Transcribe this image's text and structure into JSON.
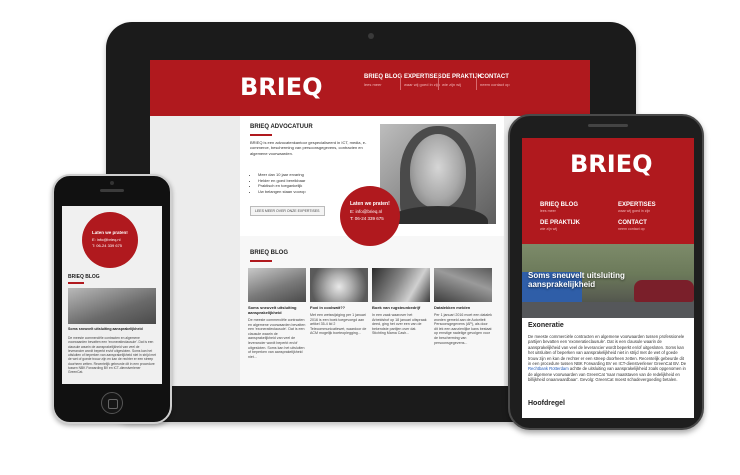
{
  "tablet": {
    "logo": "BRIEQ",
    "nav": [
      {
        "label": "BRIEQ BLOG",
        "sub": "lees meer"
      },
      {
        "label": "EXPERTISES",
        "sub": "waar wij goed in zijn"
      },
      {
        "label": "DE PRAKTIJK",
        "sub": "wie zijn wij"
      },
      {
        "label": "CONTACT",
        "sub": "neem contact op"
      }
    ],
    "about": {
      "title": "BRIEQ ADVOCATUUR",
      "text": "BRIEQ is een advocatenkantoor gespecialiseerd in ICT, media, e-commerce, bescherming van persoonsgegevens, contracten en algemene voorwaarden.",
      "bullets": [
        "Meer dan 10 jaar ervaring",
        "Helder en goed bereikbaar",
        "Praktisch en toegankelijk",
        "Uw belangen staan voorop"
      ],
      "button": "LEES MEER OVER ONZE EXPERTISES"
    },
    "contact": {
      "title": "Laten we praten!",
      "email": "E: info@brieq.nl",
      "phone": "T: 06-24 339 675"
    },
    "blog": {
      "title": "BRIEQ BLOG",
      "cards": [
        {
          "title": "Soms sneuvelt uitsluiting aansprakelijkheid",
          "text": "De meeste commerciële contracten en algemene voorwaarden bevatten een 'exoneratieclausule'. Dat is een clausule waarin de aansprakelijkheid van veel de leverancier wordt beperkt en/of uitgesloten. Soms kan het uitsluiten of beperken van aansprakelijkheid niet..."
        },
        {
          "title": "Foxi in coolwatt??",
          "text": "Met een wetswijziging per 1 januari 2016 is een boek toegevoegd aan artikel 35-4 lid 2 Telecommunicatiewet, waardoor de ACM mogelijk boeteoplegging..."
        },
        {
          "title": "Boek van rugsteunbedrijf",
          "text": "In een zaak waarover het Arbeidshof op 18 januari uitspraak deed, ging het over een van de bekendste partijen over dat. Stichting Mama Cash..."
        },
        {
          "title": "Datalekken melden",
          "text": "Per 1 januari 2016 moet een datalek worden gemeld aan de Autoriteit Persoonsgegevens (AP), als door dit lek een aanzienlijke kans bestaat op ernstige nadelige gevolgen voor de bescherming van persoonsgegevens..."
        }
      ]
    }
  },
  "iphone": {
    "contact": {
      "title": "Laten we praten!",
      "email": "E: info@brieq.nl",
      "phone": "T: 06-24 339 675"
    },
    "blog_title": "BRIEQ BLOG",
    "caption": "Soms sneuvelt uitsluiting aansprakelijkheid",
    "text": "De meeste commerciële contracten en algemene voorwaarden bevatten een 'exoneratieclausule'. Dat is een clausule waarin de aansprakelijkheid van veel de leverancier wordt beperkt en/of uitgesloten. Soms kan het uitsluiten of beperken van aansprakelijkheid niet in strijd met de wet of goede trouw zijn en kan de rechter er een streep doorheen zetten. Recentelijk gebeurde dit in een procedure tussen NBK Forwarding BV en ICT-dienstverlener GreenCat."
  },
  "android": {
    "logo": "BRIEQ",
    "nav": [
      {
        "label": "BRIEQ BLOG",
        "sub": "lees meer"
      },
      {
        "label": "EXPERTISES",
        "sub": "waar wij goed in zijn"
      },
      {
        "label": "DE PRAKTIJK",
        "sub": "wie zijn wij"
      },
      {
        "label": "CONTACT",
        "sub": "neem contact op"
      }
    ],
    "hero_title": "Soms sneuvelt uitsluiting aansprakelijkheid",
    "section_title": "Exoneratie",
    "text_a": "De meeste commerciële contracten en algemene voorwaarden tussen professionele partijen bevatten een 'exoneratieclausule'. Dat is een clausule waarin de aansprakelijkheid van veel de leverancier wordt beperkt en/of uitgesloten. Soms kan het uitsluiten of beperken van aansprakelijkheid niet in strijd met de wet of goede trouw zijn en kan de rechter er een streep doorheen zetten. Recentelijk gebeurde dit in een procedure tussen NBK Forwarding BV en ICT-dienstverlener GreenCat BV. De",
    "link": "Rechtbank Rotterdam",
    "text_b": "achtte de uitsluiting van aansprakelijkheid zoals opgenomen in de algemene voorwaarden van GreenCat 'naar maatstaven van de redelijkheid en billijkheid onaanvaardbaar'. Gevolg: GreenCat moest schadevergoeding betalen.",
    "subheading": "Hoofdregel"
  }
}
